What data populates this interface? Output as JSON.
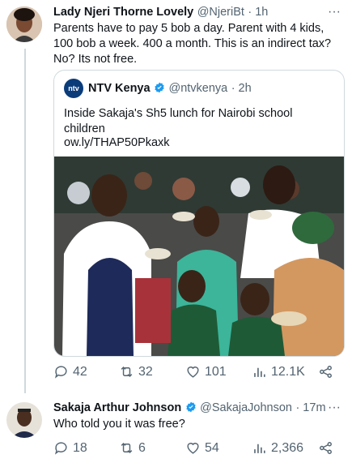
{
  "tweet1": {
    "name": "Lady Njeri Thorne Lovely",
    "handle": "@NjeriBt",
    "time": "· 1h",
    "text": "Parents have to pay 5 bob a day. Parent with 4 kids, 100 bob a week. 400 a month. This is an indirect tax? No? Its not free.",
    "quote": {
      "name": "NTV Kenya",
      "logo_text": "ntv",
      "handle": "@ntvkenya",
      "time": "· 2h",
      "text": "Inside Sakaja's Sh5 lunch for Nairobi school children",
      "link": "ow.ly/THAP50Pkaxk"
    },
    "actions": {
      "replies": "42",
      "retweets": "32",
      "likes": "101",
      "views": "12.1K"
    }
  },
  "tweet2": {
    "name": "Sakaja Arthur Johnson",
    "handle": "@SakajaJohnson",
    "time": "· 17m",
    "text": "Who told you it was free?",
    "actions": {
      "replies": "18",
      "retweets": "6",
      "likes": "54",
      "views": "2,366"
    }
  },
  "colors": {
    "verified": "#1d9bf0",
    "muted": "#536471",
    "border": "#cfd9de"
  }
}
